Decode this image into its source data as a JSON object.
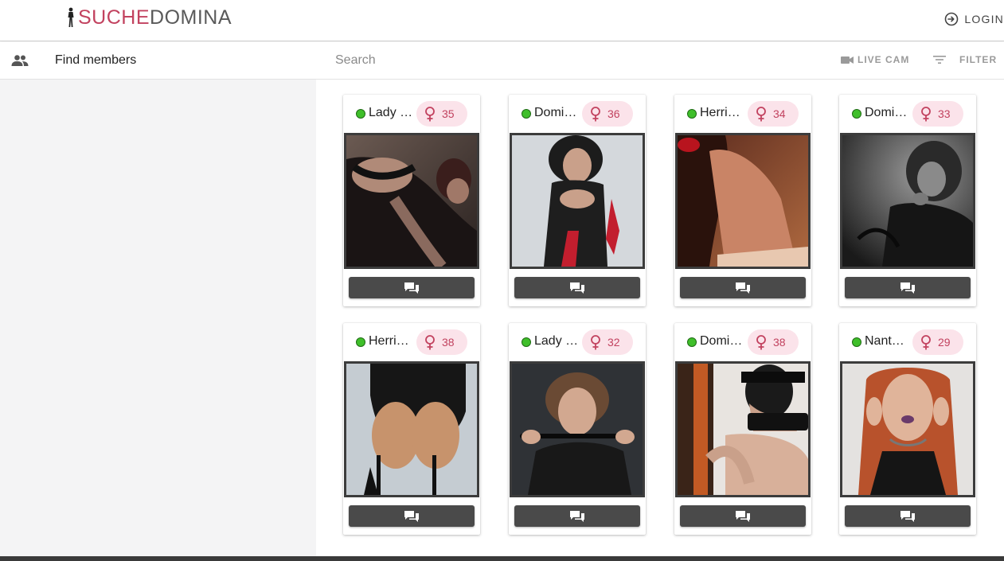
{
  "header": {
    "logo_part1": "SUCHE",
    "logo_part2": "DOMINA",
    "login_label": "LOGIN",
    "brand_color": "#c2425f"
  },
  "sidebar": {
    "find_members_label": "Find members",
    "icon": "people-icon"
  },
  "search": {
    "placeholder": "Search",
    "live_cam_label": "LIVE CAM",
    "filter_label": "FILTER"
  },
  "members": [
    {
      "name": "Lady …",
      "age": "35",
      "online": true
    },
    {
      "name": "Domi…",
      "age": "36",
      "online": true
    },
    {
      "name": "Herrin…",
      "age": "34",
      "online": true
    },
    {
      "name": "Domi…",
      "age": "33",
      "online": true
    },
    {
      "name": "Herrin…",
      "age": "38",
      "online": true
    },
    {
      "name": "Lady …",
      "age": "32",
      "online": true
    },
    {
      "name": "Domi…",
      "age": "38",
      "online": true
    },
    {
      "name": "Nanth…",
      "age": "29",
      "online": true
    }
  ],
  "colors": {
    "online": "#3fbf2a",
    "age_badge_bg": "#fbe3ea",
    "chat_button": "#4a4a4a"
  }
}
